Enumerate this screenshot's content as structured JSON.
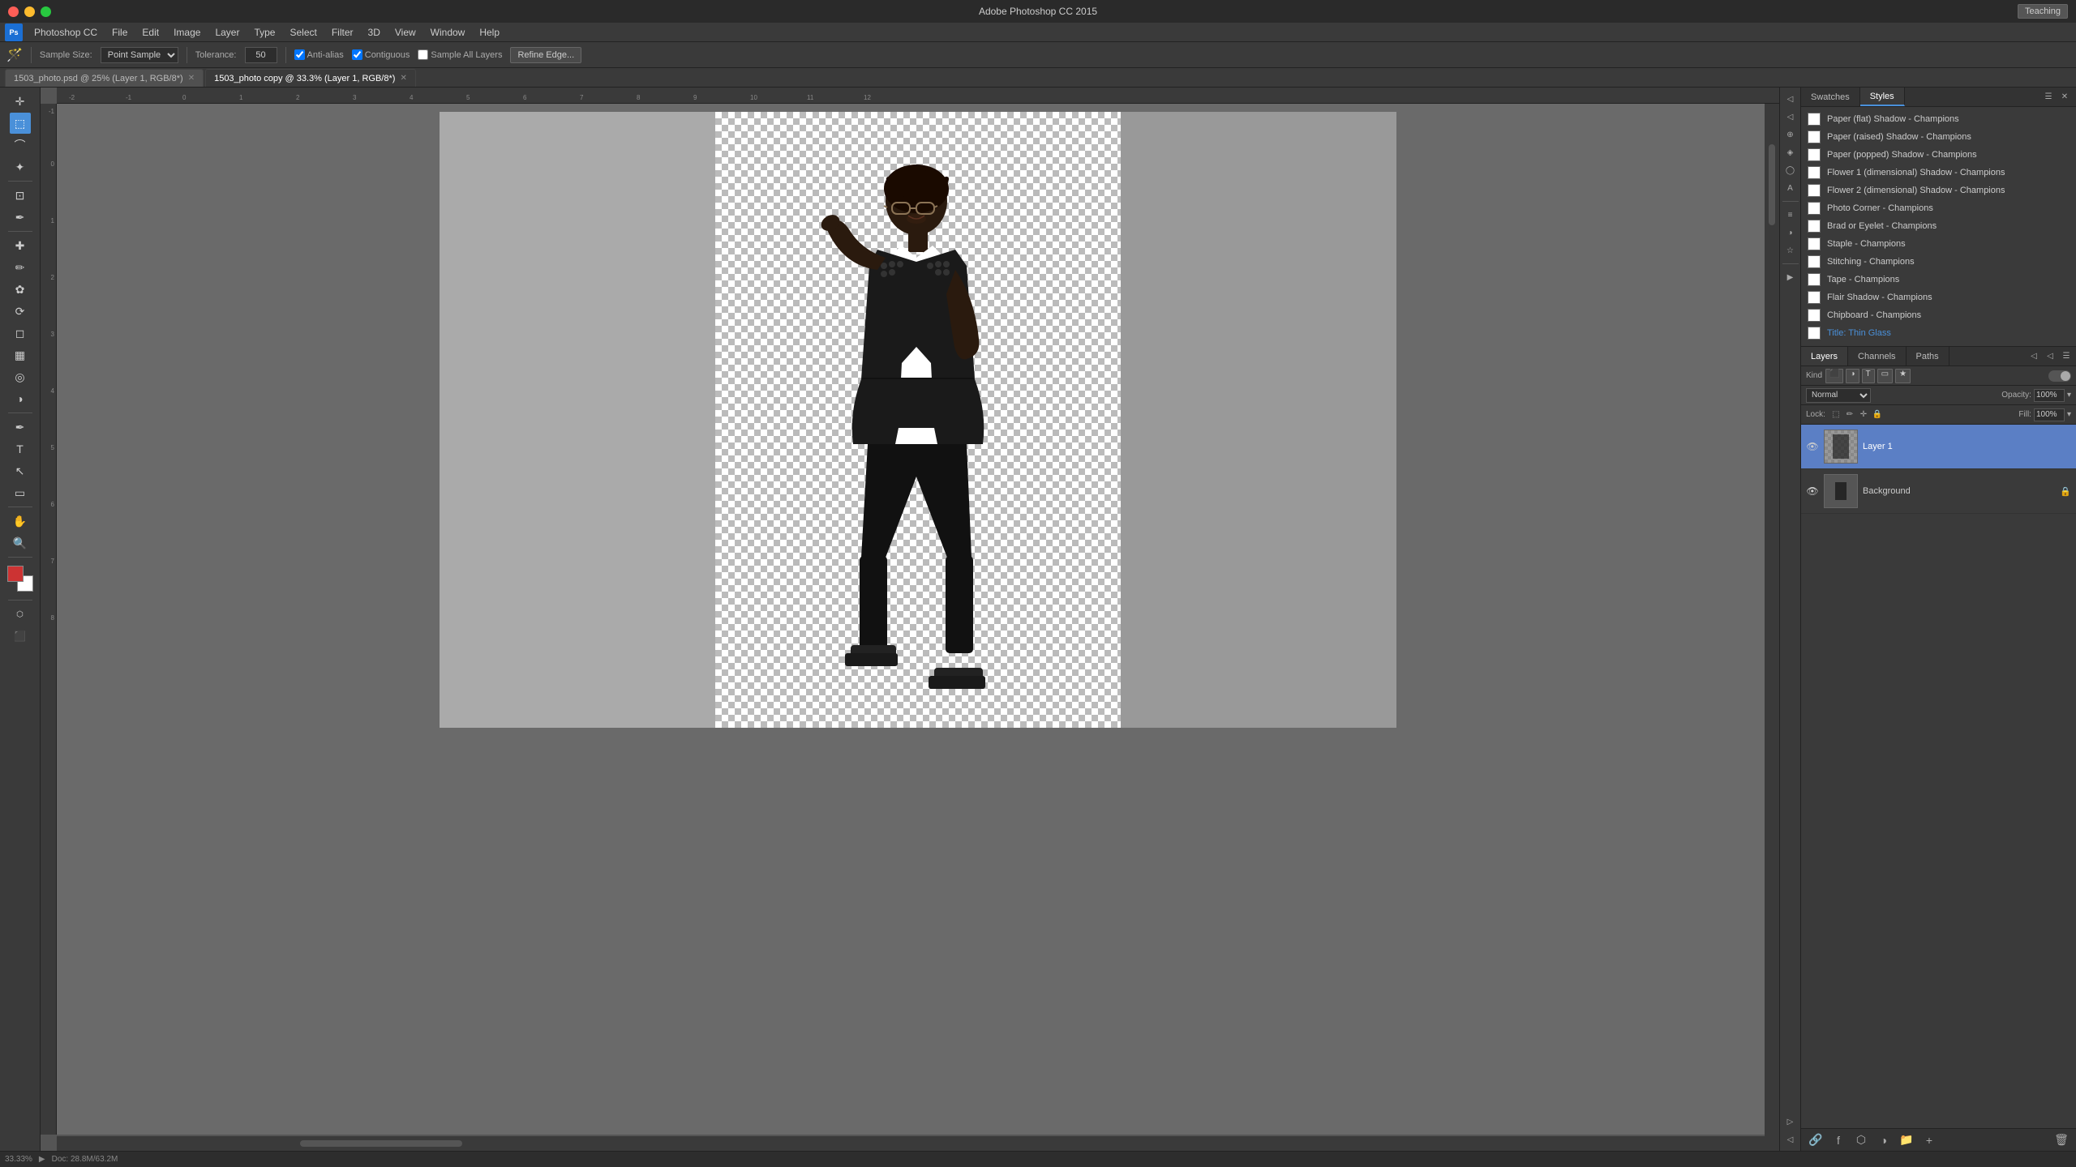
{
  "titleBar": {
    "title": "Adobe Photoshop CC 2015",
    "appName": "Ps"
  },
  "menuBar": {
    "items": [
      "Photoshop CC",
      "File",
      "Edit",
      "Image",
      "Layer",
      "Type",
      "Select",
      "Filter",
      "3D",
      "View",
      "Window",
      "Help"
    ]
  },
  "optionsBar": {
    "sampleSizeLabel": "Sample Size:",
    "sampleSizeValue": "Point Sample",
    "toleranceLabel": "Tolerance:",
    "toleranceValue": "50",
    "antiAliasLabel": "Anti-alias",
    "contiguousLabel": "Contiguous",
    "sampleAllLayersLabel": "Sample All Layers",
    "refineEdgeBtn": "Refine Edge..."
  },
  "tabs": [
    {
      "id": "tab1",
      "label": "1503_photo.psd @ 25% (Layer 1, RGB/8*)",
      "active": false
    },
    {
      "id": "tab2",
      "label": "1503_photo copy @ 33.3% (Layer 1, RGB/8*)",
      "active": true
    }
  ],
  "stylesPanel": {
    "tabs": [
      "Swatches",
      "Styles"
    ],
    "activeTab": "Styles",
    "items": [
      {
        "id": 1,
        "label": "Paper (flat) Shadow - Champions",
        "active": false
      },
      {
        "id": 2,
        "label": "Paper (raised) Shadow - Champions",
        "active": false
      },
      {
        "id": 3,
        "label": "Paper (popped) Shadow - Champions",
        "active": false
      },
      {
        "id": 4,
        "label": "Flower 1 (dimensional) Shadow - Champions",
        "active": false
      },
      {
        "id": 5,
        "label": "Flower 2 (dimensional) Shadow - Champions",
        "active": false
      },
      {
        "id": 6,
        "label": "Photo Corner - Champions",
        "active": false
      },
      {
        "id": 7,
        "label": "Brad or Eyelet - Champions",
        "active": false
      },
      {
        "id": 8,
        "label": "Staple - Champions",
        "active": false
      },
      {
        "id": 9,
        "label": "Stitching - Champions",
        "active": false
      },
      {
        "id": 10,
        "label": "Tape - Champions",
        "active": false
      },
      {
        "id": 11,
        "label": "Flair Shadow - Champions",
        "active": false
      },
      {
        "id": 12,
        "label": "Chipboard - Champions",
        "active": false
      },
      {
        "id": 13,
        "label": "Title: Thin Glass",
        "active": false,
        "highlight": true
      }
    ]
  },
  "layersPanel": {
    "tabs": [
      "Layers",
      "Channels",
      "Paths"
    ],
    "activeTab": "Layers",
    "filterLabel": "Kind",
    "blendMode": "Normal",
    "opacityLabel": "Opacity:",
    "opacityValue": "100%",
    "fillLabel": "Fill:",
    "fillValue": "100%",
    "lockLabel": "Lock:",
    "layers": [
      {
        "id": 1,
        "name": "Layer 1",
        "visible": true,
        "selected": true,
        "hasChecker": true,
        "locked": false
      },
      {
        "id": 2,
        "name": "Background",
        "visible": true,
        "selected": false,
        "hasChecker": false,
        "locked": true
      }
    ]
  },
  "statusBar": {
    "zoom": "33.33%",
    "docInfo": "Doc: 28.8M/63.2M"
  },
  "teachingBadge": "Teaching",
  "canvas": {
    "rulerNumbers": [
      "-2",
      "-1",
      "0",
      "1",
      "2",
      "3",
      "4",
      "5",
      "6",
      "7",
      "8",
      "9",
      "10",
      "11",
      "12"
    ],
    "leftRulerNumbers": [
      "-1",
      "0",
      "1",
      "2",
      "3",
      "4",
      "5",
      "6",
      "7",
      "8"
    ]
  }
}
